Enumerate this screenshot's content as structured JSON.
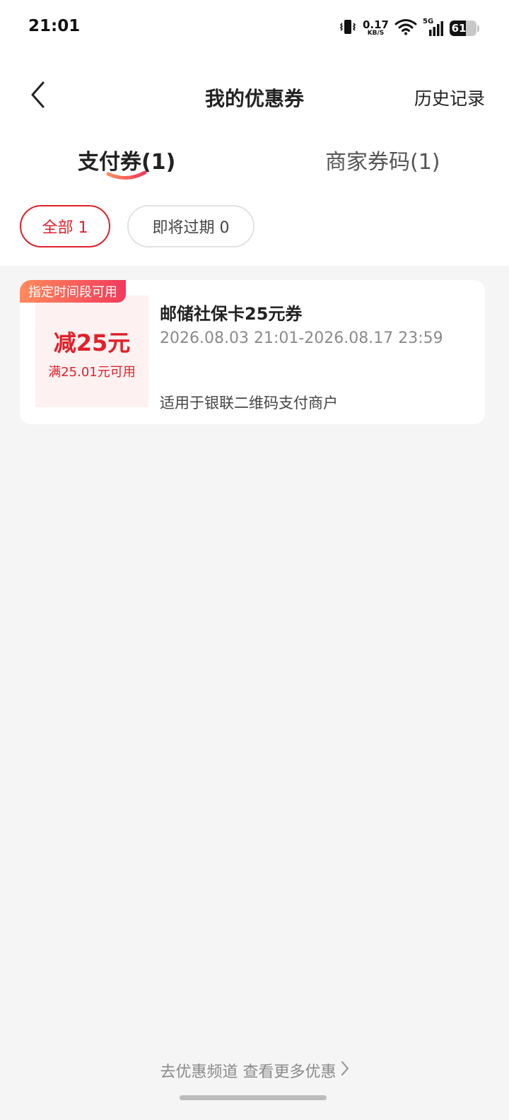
{
  "status_bar": {
    "time": "21:01",
    "net_speed_value": "0.17",
    "net_speed_unit": "KB/S",
    "network_type": "5G",
    "battery_level": "61"
  },
  "header": {
    "title": "我的优惠券",
    "history_label": "历史记录",
    "back_icon": "chevron-left-icon"
  },
  "tabs": [
    {
      "label": "支付券(1)",
      "active": true
    },
    {
      "label": "商家券码(1)",
      "active": false
    }
  ],
  "filters": [
    {
      "label": "全部 1",
      "active": true
    },
    {
      "label": "即将过期 0",
      "active": false
    }
  ],
  "coupon": {
    "tag": "指定时间段可用",
    "amount": "减25元",
    "condition": "满25.01元可用",
    "name": "邮储社保卡25元券",
    "validity": "2026.08.03 21:01-2026.08.17 23:59",
    "scope": "适用于银联二维码支付商户"
  },
  "footer": {
    "more_link": "去优惠频道 查看更多优惠"
  },
  "colors": {
    "accent": "#e0202a",
    "tag_gradient_start": "#ff8a5c",
    "tag_gradient_end": "#f23a5c",
    "page_background": "#f5f5f5"
  }
}
